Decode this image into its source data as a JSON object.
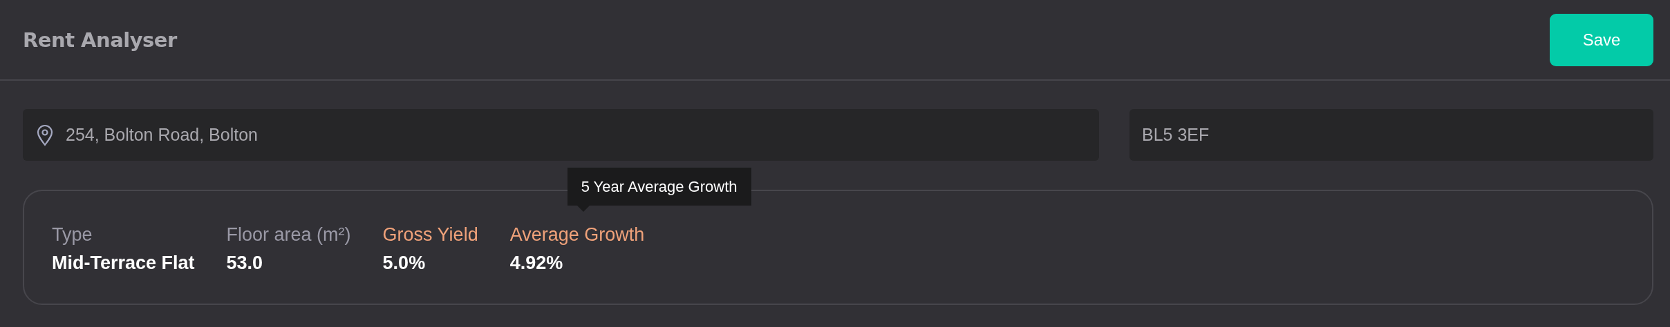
{
  "header": {
    "title": "Rent Analyser",
    "save_button": "Save"
  },
  "address_field": {
    "value": "254, Bolton Road, Bolton"
  },
  "postcode_field": {
    "value": "BL5 3EF"
  },
  "stats": [
    {
      "label": "Type",
      "value": "Mid-Terrace Flat",
      "highlighted": false
    },
    {
      "label": "Floor area (m²)",
      "value": "53.0",
      "highlighted": false
    },
    {
      "label": "Gross Yield",
      "value": "5.0%",
      "highlighted": true
    },
    {
      "label": "Average Growth",
      "value": "4.92%",
      "highlighted": true,
      "tooltip": "5 Year Average Growth"
    }
  ]
}
